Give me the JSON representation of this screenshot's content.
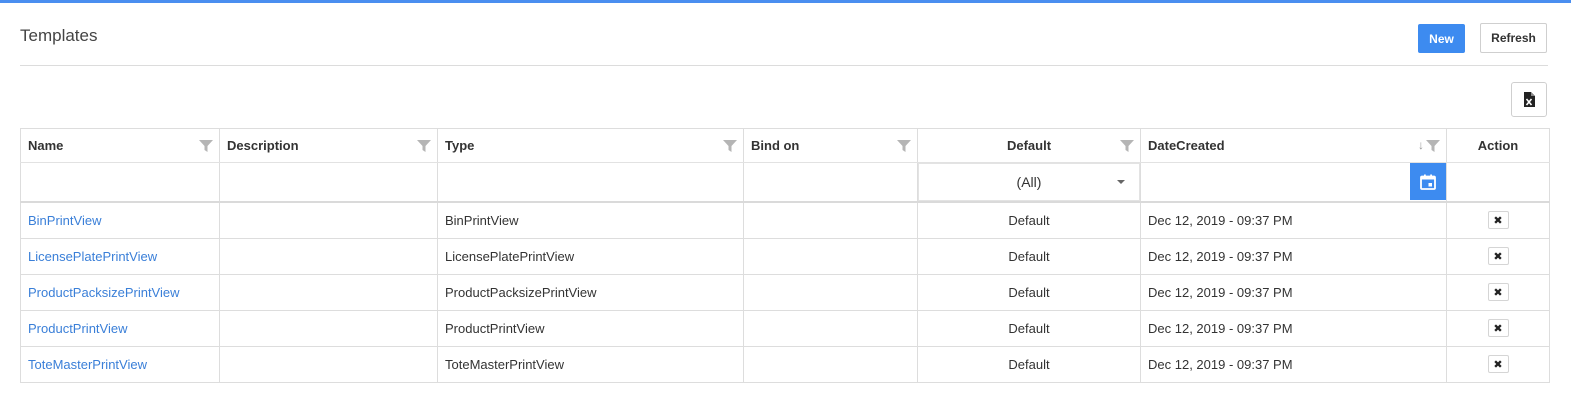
{
  "header": {
    "title": "Templates",
    "new_label": "New",
    "refresh_label": "Refresh",
    "excel_icon": "excel-export-icon"
  },
  "colors": {
    "accent": "#3d8bf0",
    "link": "#3a7fd8",
    "top_bar": "#4a8ef0"
  },
  "grid": {
    "columns": {
      "name": "Name",
      "description": "Description",
      "type": "Type",
      "bind_on": "Bind on",
      "default": "Default",
      "date_created": "DateCreated",
      "action": "Action"
    },
    "date_sort_indicator": "↓",
    "filters": {
      "default_select": "(All)"
    },
    "rows": [
      {
        "name": "BinPrintView",
        "description": "",
        "type": "BinPrintView",
        "bind_on": "",
        "default": "Default",
        "date_created": "Dec 12, 2019 - 09:37 PM",
        "action": "✖"
      },
      {
        "name": "LicensePlatePrintView",
        "description": "",
        "type": "LicensePlatePrintView",
        "bind_on": "",
        "default": "Default",
        "date_created": "Dec 12, 2019 - 09:37 PM",
        "action": "✖"
      },
      {
        "name": "ProductPacksizePrintView",
        "description": "",
        "type": "ProductPacksizePrintView",
        "bind_on": "",
        "default": "Default",
        "date_created": "Dec 12, 2019 - 09:37 PM",
        "action": "✖"
      },
      {
        "name": "ProductPrintView",
        "description": "",
        "type": "ProductPrintView",
        "bind_on": "",
        "default": "Default",
        "date_created": "Dec 12, 2019 - 09:37 PM",
        "action": "✖"
      },
      {
        "name": "ToteMasterPrintView",
        "description": "",
        "type": "ToteMasterPrintView",
        "bind_on": "",
        "default": "Default",
        "date_created": "Dec 12, 2019 - 09:37 PM",
        "action": "✖"
      }
    ]
  }
}
